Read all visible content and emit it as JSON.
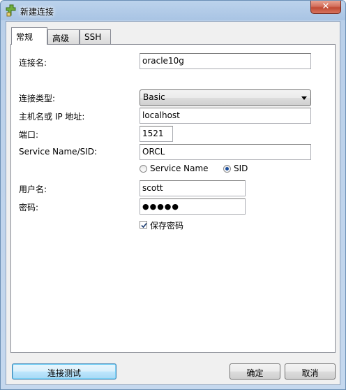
{
  "window": {
    "title": "新建连接"
  },
  "tabs": [
    {
      "label": "常规"
    },
    {
      "label": "高级"
    },
    {
      "label": "SSH"
    }
  ],
  "form": {
    "connection_name_label": "连接名:",
    "connection_name_value": "oracle10g",
    "connection_type_label": "连接类型:",
    "connection_type_value": "Basic",
    "host_label": "主机名或 IP 地址:",
    "host_value": "localhost",
    "port_label": "端口:",
    "port_value": "1521",
    "service_label": "Service Name/SID:",
    "service_value": "ORCL",
    "radio_service_name": "Service Name",
    "radio_sid": "SID",
    "radio_selected": "SID",
    "username_label": "用户名:",
    "username_value": "scott",
    "password_label": "密码:",
    "password_value": "●●●●●",
    "save_password_label": "保存密码",
    "save_password_checked": true
  },
  "buttons": {
    "test_connection": "连接测试",
    "ok": "确定",
    "cancel": "取消"
  },
  "icons": {
    "app": "new-connection-icon",
    "close": "close-icon",
    "dropdown": "chevron-down-icon",
    "check": "check-icon"
  }
}
